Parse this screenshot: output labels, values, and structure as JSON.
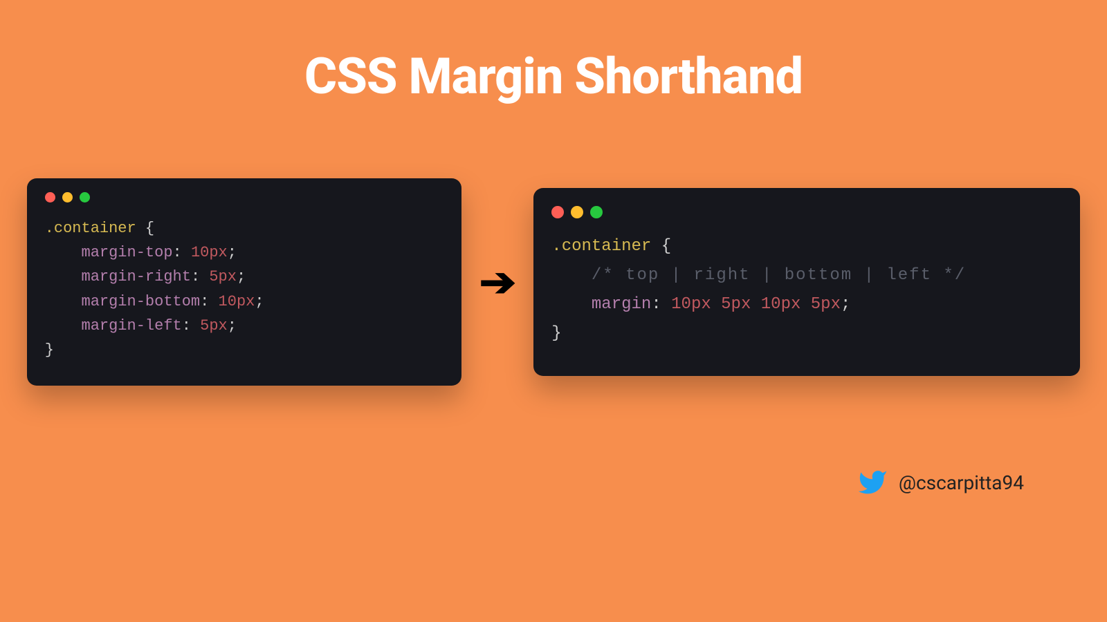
{
  "title": "CSS Margin Shorthand",
  "left": {
    "selector": ".container",
    "open": "{",
    "close": "}",
    "lines": [
      {
        "prop": "margin-top",
        "val": "10px"
      },
      {
        "prop": "margin-right",
        "val": "5px"
      },
      {
        "prop": "margin-bottom",
        "val": "10px"
      },
      {
        "prop": "margin-left",
        "val": "5px"
      }
    ],
    "colon": ":",
    "semi": ";"
  },
  "arrow": "➔",
  "right": {
    "selector": ".container",
    "open": "{",
    "close": "}",
    "comment": "/* top | right | bottom | left */",
    "prop": "margin",
    "val": "10px 5px 10px 5px",
    "colon": ":",
    "semi": ";"
  },
  "credit": {
    "handle": "@cscarpitta94"
  }
}
